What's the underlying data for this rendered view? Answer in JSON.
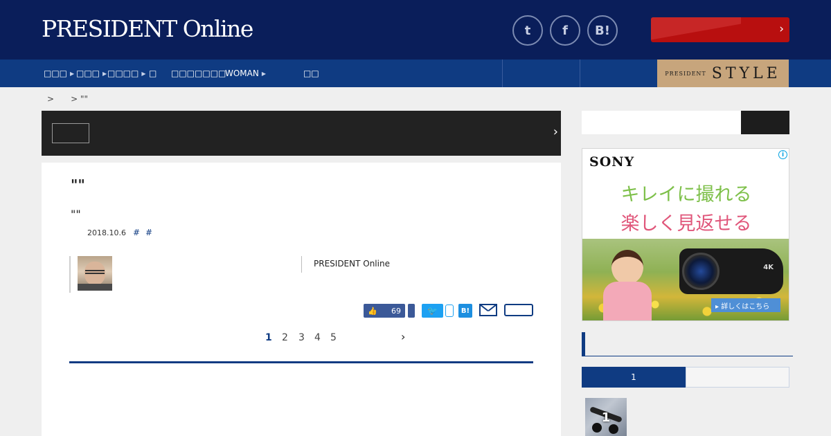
{
  "header": {
    "logo": "PRESIDENT Online",
    "social": {
      "twitter": "t",
      "facebook": "f",
      "hatena": "B!"
    },
    "cta_arrow": "›"
  },
  "nav": {
    "items": [
      {
        "label": "□□□",
        "has_arrow": true
      },
      {
        "label": "□□□",
        "has_arrow": true
      },
      {
        "label": "□□□□",
        "has_arrow": true
      },
      {
        "label": "□",
        "has_arrow": false
      },
      {
        "label": "□□□□□□□",
        "has_arrow": false
      },
      {
        "label": "WOMAN",
        "has_arrow": true
      },
      {
        "label": "□□",
        "has_arrow": false
      }
    ],
    "style_banner": {
      "small": "PRESIDENT",
      "big": "STYLE"
    }
  },
  "breadcrumb": {
    "sep1": ">",
    "sep2": ">",
    "current": "\"\""
  },
  "dark_banner": {
    "arrow": "›"
  },
  "article": {
    "title": "\"\"",
    "subtitle": "\"\"",
    "date": "2018.10.6",
    "tags": [
      "#",
      "#"
    ],
    "credit": "PRESIDENT Online",
    "like_count": "69",
    "share_hatena": "B!",
    "pages": [
      "1",
      "2",
      "3",
      "4",
      "5"
    ],
    "current_page": "1",
    "next_arrow": "›"
  },
  "sidebar": {
    "ad": {
      "brand": "SONY",
      "line1": "キレイに撮れる",
      "line2": "楽しく見返せる",
      "camera_label": "4K",
      "cta": "▸ 詳しくはこちら",
      "info": "i"
    },
    "ranking": {
      "tab1": "1",
      "thumb_rank": "1"
    }
  },
  "colors": {
    "header_bg": "#0a1e5a",
    "nav_bg": "#0f3b82",
    "accent": "#0f3b82",
    "cta": "#b80f0f",
    "style_banner": "#c7a57c"
  }
}
